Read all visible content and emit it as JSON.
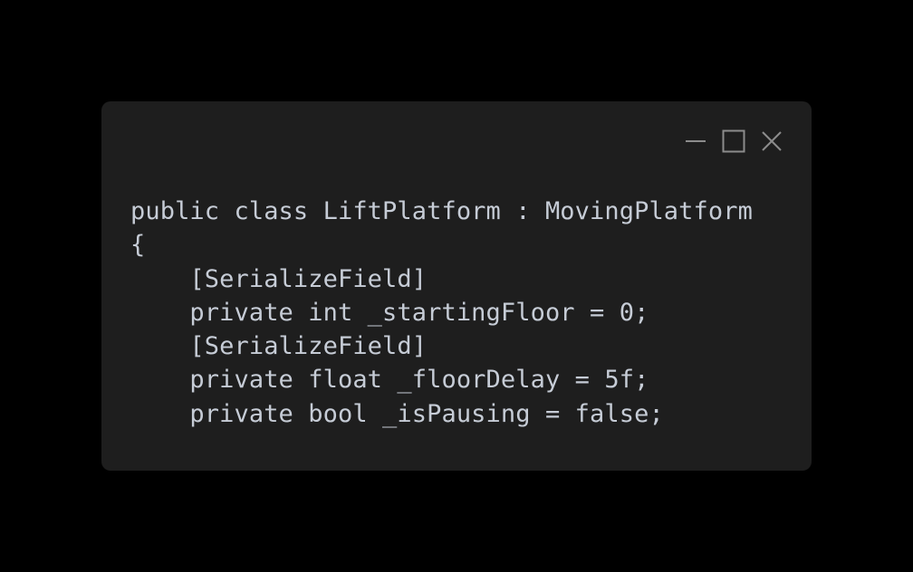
{
  "window": {
    "background": "#1e1e1e",
    "controls": [
      {
        "name": "minimize-icon",
        "icon": "minimize"
      },
      {
        "name": "maximize-icon",
        "icon": "maximize"
      },
      {
        "name": "close-icon",
        "icon": "close"
      }
    ],
    "control_color": "#8c8c8c"
  },
  "code": {
    "text_color": "#c6ccd6",
    "lines": [
      "public class LiftPlatform : MovingPlatform",
      "{",
      "    [SerializeField]",
      "    private int _startingFloor = 0;",
      "    [SerializeField]",
      "    private float _floorDelay = 5f;",
      "    private bool _isPausing = false;"
    ]
  }
}
